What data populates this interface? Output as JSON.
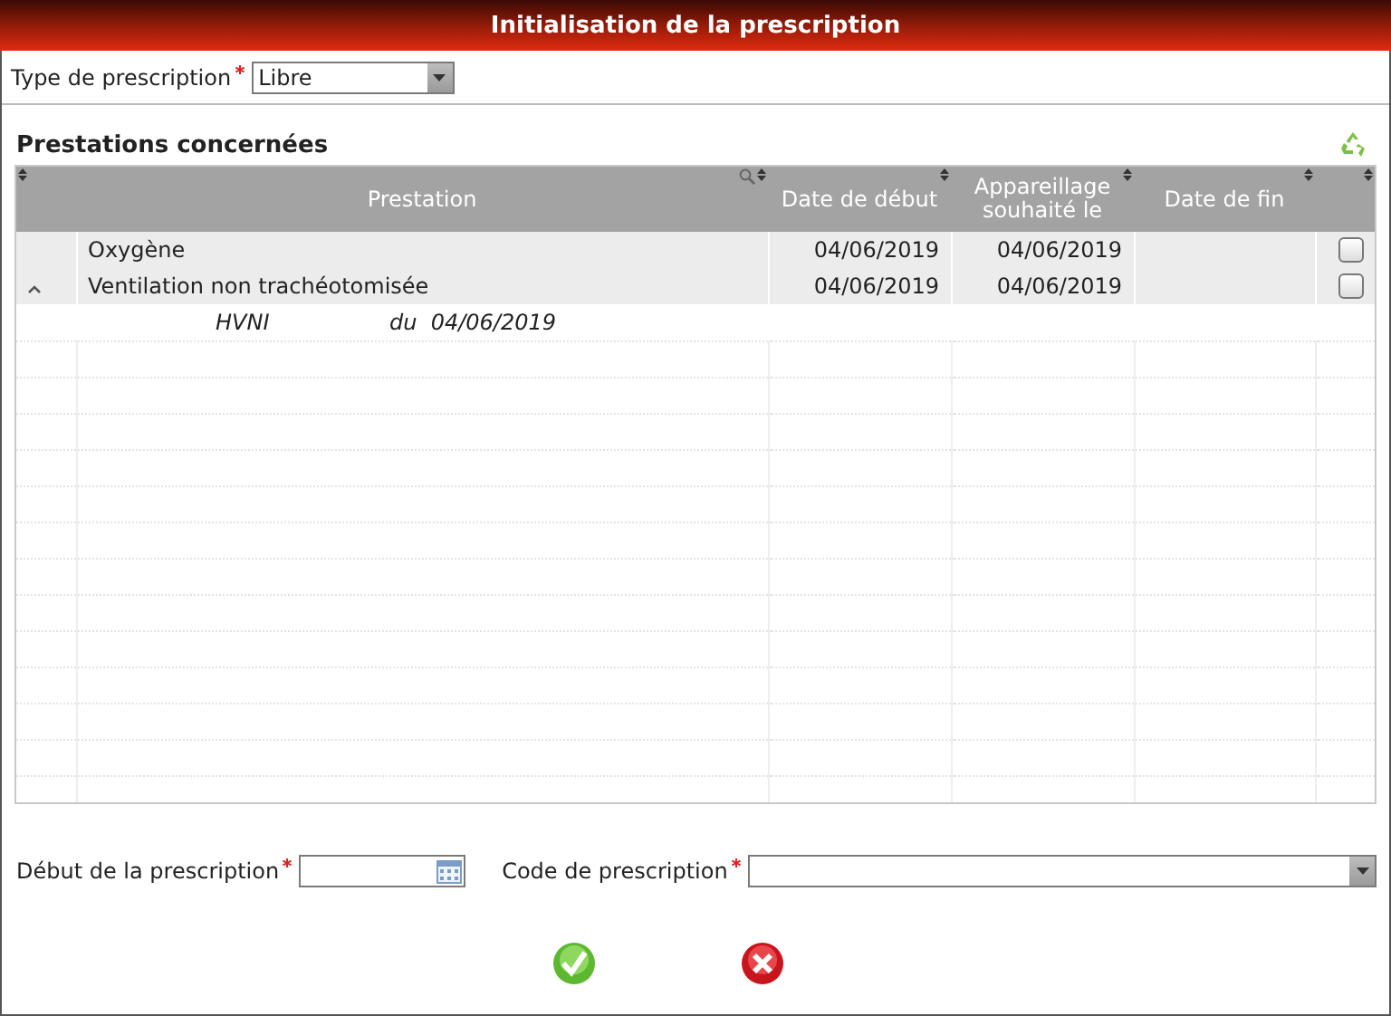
{
  "window": {
    "title": "Initialisation de la prescription"
  },
  "type_field": {
    "label": "Type de prescription",
    "required": true,
    "value": "Libre"
  },
  "section": {
    "title": "Prestations concernées"
  },
  "table": {
    "columns": [
      {
        "label": "Prestation",
        "filter": true
      },
      {
        "label": "Date de début",
        "filter": false
      },
      {
        "label": "Appareillage souhaité le",
        "filter": false
      },
      {
        "label": "Date de fin",
        "filter": false
      }
    ],
    "rows": [
      {
        "expandable": false,
        "prestation": "Oxygène",
        "date_debut": "04/06/2019",
        "appareillage": "04/06/2019",
        "checked": false,
        "details": []
      },
      {
        "expandable": true,
        "expanded": true,
        "prestation": "Ventilation non trachéotomisée",
        "date_debut": "04/06/2019",
        "appareillage": "04/06/2019",
        "checked": false,
        "details": [
          {
            "code": "HVNI",
            "prefix": "du",
            "date": "04/06/2019"
          }
        ]
      }
    ]
  },
  "start_field": {
    "label": "Début de la prescription",
    "required": true
  },
  "code_field": {
    "label": "Code de prescription",
    "required": true
  },
  "buttons": [
    {
      "kind": "confirm"
    },
    {
      "kind": "cancel"
    }
  ]
}
